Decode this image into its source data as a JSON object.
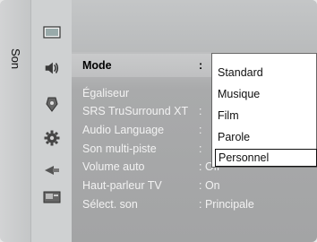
{
  "side_tab": {
    "label": "Son"
  },
  "icons": [
    {
      "name": "picture-icon"
    },
    {
      "name": "sound-icon"
    },
    {
      "name": "channel-icon"
    },
    {
      "name": "settings-gear-icon"
    },
    {
      "name": "input-icon"
    },
    {
      "name": "application-icon"
    }
  ],
  "menu": {
    "items": [
      {
        "label": "Mode",
        "value": ":"
      },
      {
        "label": "Égaliseur",
        "value": ""
      },
      {
        "label": "SRS TruSurround XT",
        "value": ":"
      },
      {
        "label": "Audio Language",
        "value": ":"
      },
      {
        "label": "Son multi-piste",
        "value": ":"
      },
      {
        "label": "Volume auto",
        "value": ": Off"
      },
      {
        "label": "Haut-parleur TV",
        "value": ": On"
      },
      {
        "label": "Sélect. son",
        "value": ": Principale"
      }
    ]
  },
  "dropdown": {
    "options": [
      "Standard",
      "Musique",
      "Film",
      "Parole",
      "Personnel"
    ],
    "focused": "Personnel"
  },
  "colors": {
    "selected_text": "#000000",
    "disabled_text": "#f2f2f2",
    "panel": "#a9aaab"
  }
}
